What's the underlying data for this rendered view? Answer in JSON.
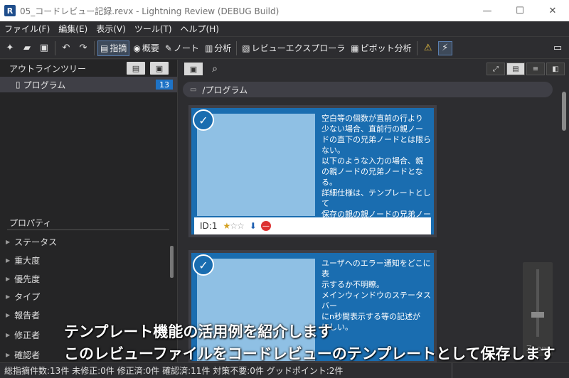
{
  "window": {
    "title": "05_コードレビュー記録.revx  - Lightning Review (DEBUG Build)",
    "icon_letter": "R",
    "controls": [
      "—",
      "☐",
      "✕"
    ]
  },
  "menu": [
    "ファイル(F)",
    "編集(E)",
    "表示(V)",
    "ツール(T)",
    "ヘルプ(H)"
  ],
  "toolbar": {
    "buttons": {
      "shiteki": "指摘",
      "gaiyo": "概要",
      "note": "ノート",
      "bunseki": "分析",
      "explorer": "レビューエクスプローラ",
      "pivot": "ピボット分析"
    }
  },
  "outline": {
    "header": "アウトラインツリー",
    "item_label": "プログラム",
    "item_count": "13"
  },
  "properties": {
    "header": "プロパティ",
    "items": [
      "ステータス",
      "重大度",
      "優先度",
      "タイプ",
      "報告者",
      "修正者",
      "確認者"
    ]
  },
  "main": {
    "breadcrumb": "/プログラム",
    "cards": [
      {
        "text": "空白等の個数が直前の行より\n少ない場合、直前行の親ノー\nドの直下の兄弟ノードとは限ら\nない。\n以下のような入力の場合、親\nの親ノードの兄弟ノードとなる。\n詳細仕様は、テンプレートとして\n保存の親の親ノードの兄弟ノー\nドとなる。",
        "id_label": "ID:1",
        "rating": 1
      },
      {
        "text": "ユーザへのエラー通知をどこに表\n示するか不明瞭。\nメインウィンドウのステータスバー\nにn秒間表示する等の記述が\nほしい。"
      }
    ],
    "zoom_label": "Zoom"
  },
  "subtitles": [
    "テンプレート機能の活用例を紹介します",
    "このレビューファイルをコードレビューのテンプレートとして保存します"
  ],
  "statusbar": "総指摘件数:13件  未修正:0件  修正済:0件  確認済:11件  対策不要:0件  グッドポイント:2件"
}
